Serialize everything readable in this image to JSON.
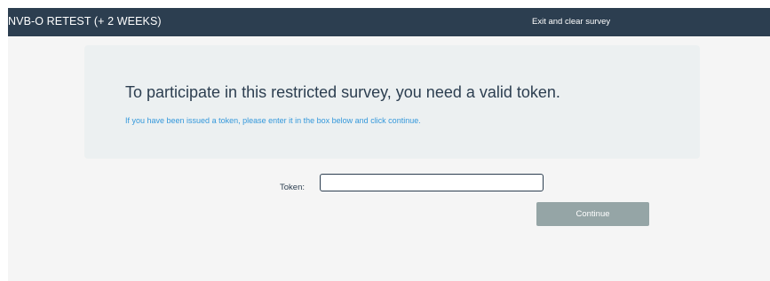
{
  "navbar": {
    "brand": "NVB-O RETEST (+ 2 WEEKS)",
    "exit_link": "Exit and clear survey"
  },
  "jumbotron": {
    "title": "To participate in this restricted survey, you need a valid token.",
    "subtitle": "If you have been issued a token, please enter it in the box below and click continue."
  },
  "form": {
    "token_label": "Token:",
    "token_value": "",
    "token_placeholder": "",
    "continue_label": "Continue"
  },
  "colors": {
    "navbar_bg": "#2c3e50",
    "page_bg": "#f5f5f5",
    "panel_bg": "#ecf0f1",
    "link_blue": "#3498db",
    "button_gray": "#95a5a6"
  }
}
